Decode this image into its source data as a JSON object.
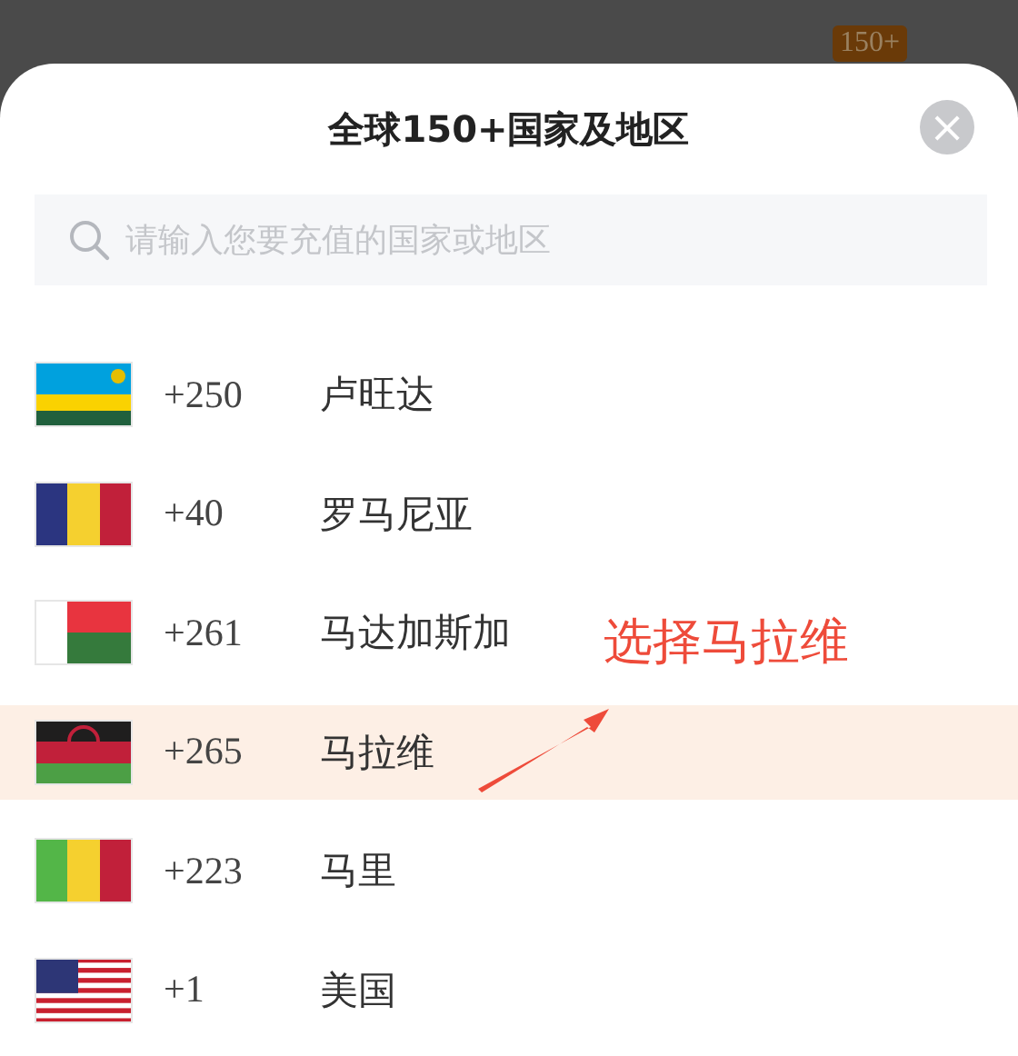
{
  "backdrop": {
    "badge": "150+"
  },
  "sheet": {
    "title": "全球150+国家及地区",
    "close": "×",
    "search": {
      "placeholder": "请输入您要充值的国家或地区"
    },
    "countries": [
      {
        "kind": "rw",
        "code": "+250",
        "name": "卢旺达",
        "selected": false
      },
      {
        "kind": "ro",
        "code": "+40",
        "name": "罗马尼亚",
        "selected": false
      },
      {
        "kind": "mg",
        "code": "+261",
        "name": "马达加斯加",
        "selected": false
      },
      {
        "kind": "mw",
        "code": "+265",
        "name": "马拉维",
        "selected": true
      },
      {
        "kind": "ml",
        "code": "+223",
        "name": "马里",
        "selected": false
      },
      {
        "kind": "us",
        "code": "+1",
        "name": "美国",
        "selected": false
      }
    ]
  },
  "annotation": {
    "text": "选择马拉维"
  }
}
